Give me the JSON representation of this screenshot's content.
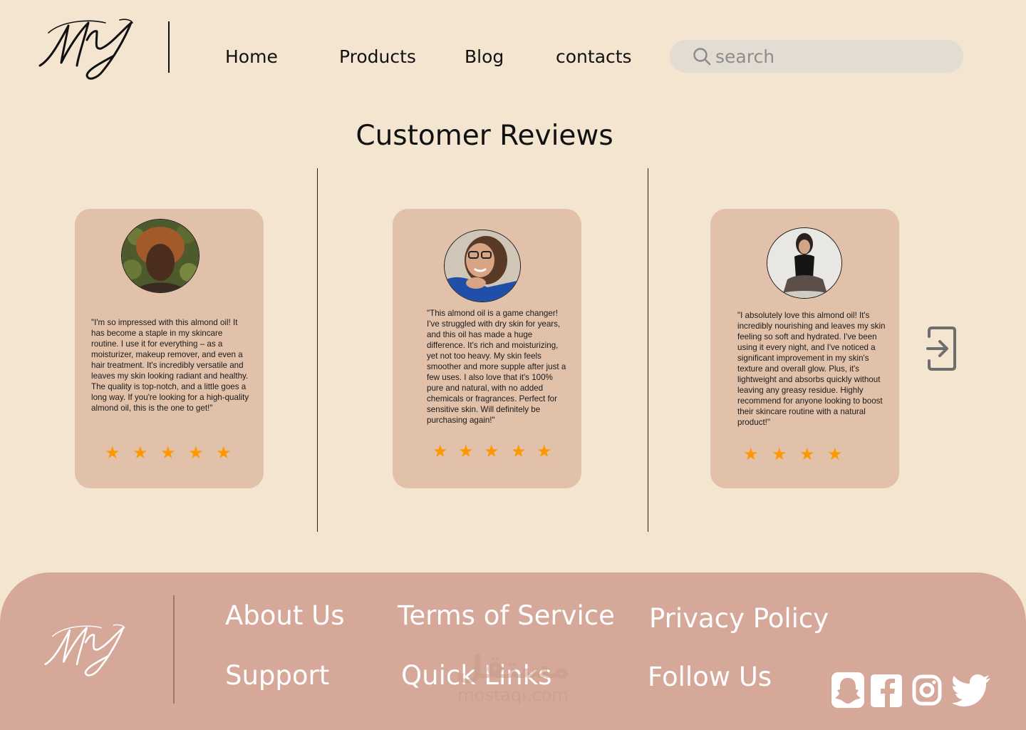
{
  "header": {
    "logo_text": "MY",
    "nav": [
      {
        "label": "Home"
      },
      {
        "label": "Products"
      },
      {
        "label": "Blog"
      },
      {
        "label": "contacts"
      }
    ],
    "search": {
      "placeholder": "search",
      "value": ""
    }
  },
  "section": {
    "title": "Customer Reviews"
  },
  "reviews": [
    {
      "text": "\"I'm so impressed with this almond oil! It has become a staple in my skincare routine. I use it for everything – as a moisturizer, makeup remover, and even a hair treatment. It's incredibly versatile and leaves my skin looking radiant and healthy. The quality is top-notch, and a little goes a long way. If you're looking for a high-quality almond oil, this is the one to get!\"",
      "rating": 5
    },
    {
      "text": "\"This almond oil is a game changer! I've struggled with dry skin for years, and this oil has made a huge difference. It's rich and moisturizing, yet not too heavy. My skin feels smoother and more supple after just a few uses. I also love that it's 100% pure and natural, with no added chemicals or fragrances. Perfect for sensitive skin. Will definitely be purchasing again!\"",
      "rating": 5
    },
    {
      "text": "\"I absolutely love this almond oil! It's incredibly nourishing and leaves my skin feeling so soft and hydrated. I've been using it every night, and I've noticed a significant improvement in my skin's texture and overall glow. Plus, it's lightweight and absorbs quickly without leaving any greasy residue. Highly recommend for anyone looking to boost their skincare routine with a natural product!\"",
      "rating": 4
    }
  ],
  "icons": {
    "star": "star-icon",
    "next": "next-arrow-icon",
    "search": "search-icon",
    "social": [
      "snapchat-icon",
      "facebook-icon",
      "instagram-icon",
      "twitter-icon"
    ]
  },
  "colors": {
    "background": "#f4e5d0",
    "card": "#e2c1ab",
    "star": "#ff9800",
    "footer": "#d6a899",
    "footer_text": "#ffffff",
    "search_bg": "#e3dcd2"
  },
  "footer": {
    "logo_text": "MY",
    "links": [
      {
        "label": "About Us"
      },
      {
        "label": "Terms of Service"
      },
      {
        "label": "Privacy Policy"
      },
      {
        "label": "Support"
      },
      {
        "label": "Quick Links"
      },
      {
        "label": "Follow Us"
      }
    ],
    "watermark": {
      "arabic": "مستقل",
      "latin": "mostaqi.com"
    }
  }
}
